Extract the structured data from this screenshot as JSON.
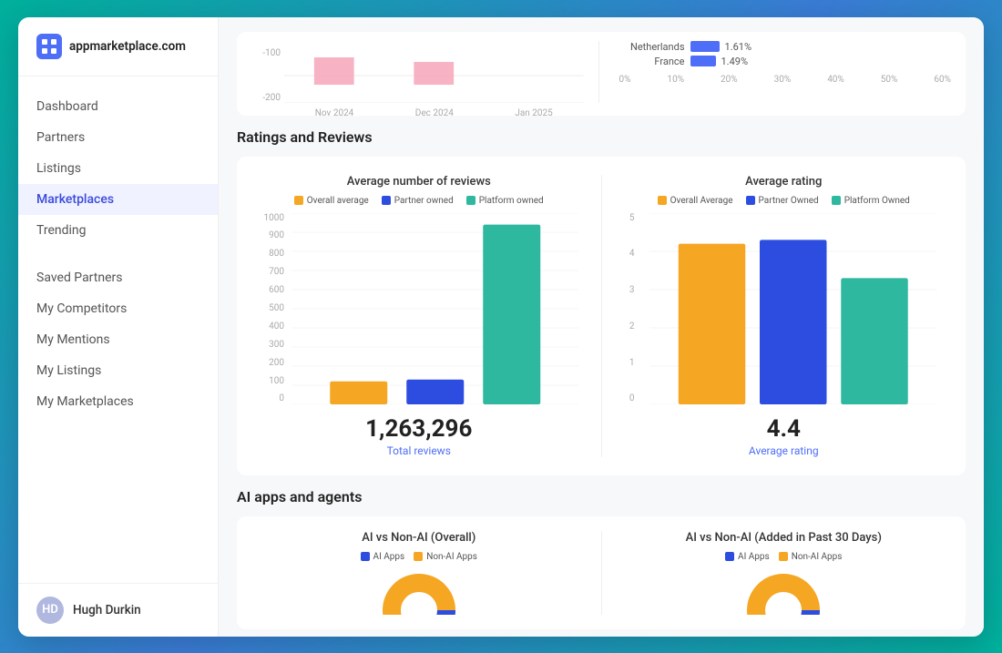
{
  "logo": {
    "domain": "appmarketplace.com"
  },
  "sidebar": {
    "nav_main": [
      {
        "label": "Dashboard",
        "active": false,
        "id": "dashboard"
      },
      {
        "label": "Partners",
        "active": false,
        "id": "partners"
      },
      {
        "label": "Listings",
        "active": false,
        "id": "listings"
      },
      {
        "label": "Marketplaces",
        "active": true,
        "id": "marketplaces"
      },
      {
        "label": "Trending",
        "active": false,
        "id": "trending"
      }
    ],
    "nav_secondary": [
      {
        "label": "Saved Partners",
        "active": false,
        "id": "saved-partners"
      },
      {
        "label": "My Competitors",
        "active": false,
        "id": "my-competitors"
      },
      {
        "label": "My Mentions",
        "active": false,
        "id": "my-mentions"
      },
      {
        "label": "My Listings",
        "active": false,
        "id": "my-listings"
      },
      {
        "label": "My Marketplaces",
        "active": false,
        "id": "my-marketplaces"
      }
    ],
    "user": {
      "name": "Hugh Durkin",
      "initials": "HD"
    }
  },
  "top_chart": {
    "left": {
      "y_labels": [
        "-100",
        "-200"
      ],
      "x_labels": [
        "Nov 2024",
        "Dec 2024",
        "Jan 2025"
      ]
    },
    "right": {
      "bars": [
        {
          "label": "Netherlands",
          "pct": "1.61%",
          "value": 1.61,
          "color": "#4f6ef7"
        },
        {
          "label": "France",
          "pct": "1.49%",
          "value": 1.49,
          "color": "#4f6ef7"
        }
      ],
      "axis": [
        "0%",
        "10%",
        "20%",
        "30%",
        "40%",
        "50%",
        "60%"
      ]
    }
  },
  "ratings_section": {
    "title": "Ratings and Reviews",
    "avg_reviews": {
      "chart_title": "Average number of reviews",
      "legend": [
        {
          "label": "Overall average",
          "color": "#f5a623"
        },
        {
          "label": "Partner owned",
          "color": "#2d4de0"
        },
        {
          "label": "Platform owned",
          "color": "#2eb8a0"
        }
      ],
      "bars": [
        {
          "label": "Overall average",
          "value": 120,
          "max": 1000,
          "color": "#f5a623"
        },
        {
          "label": "Partner owned",
          "value": 130,
          "max": 1000,
          "color": "#2d4de0"
        },
        {
          "label": "Platform owned",
          "value": 940,
          "max": 1000,
          "color": "#2eb8a0"
        }
      ],
      "y_labels": [
        "1000",
        "900",
        "800",
        "700",
        "600",
        "500",
        "400",
        "300",
        "200",
        "100",
        "0"
      ],
      "stat_number": "1,263,296",
      "stat_label": "Total reviews"
    },
    "avg_rating": {
      "chart_title": "Average rating",
      "legend": [
        {
          "label": "Overall Average",
          "color": "#f5a623"
        },
        {
          "label": "Partner Owned",
          "color": "#2d4de0"
        },
        {
          "label": "Platform Owned",
          "color": "#2eb8a0"
        }
      ],
      "bars": [
        {
          "label": "Overall Average",
          "value": 4.2,
          "max": 5,
          "color": "#f5a623"
        },
        {
          "label": "Partner Owned",
          "value": 4.3,
          "max": 5,
          "color": "#2d4de0"
        },
        {
          "label": "Platform Owned",
          "value": 3.3,
          "max": 5,
          "color": "#2eb8a0"
        }
      ],
      "y_labels": [
        "5",
        "4",
        "3",
        "2",
        "1",
        "0"
      ],
      "stat_number": "4.4",
      "stat_label": "Average rating"
    }
  },
  "ai_section": {
    "title": "AI apps and agents",
    "overall": {
      "chart_title": "AI vs Non-AI (Overall)",
      "legend": [
        {
          "label": "AI Apps",
          "color": "#2d4de0"
        },
        {
          "label": "Non-AI Apps",
          "color": "#f5a623"
        }
      ]
    },
    "past30": {
      "chart_title": "AI vs Non-AI (Added in Past 30 Days)",
      "legend": [
        {
          "label": "AI Apps",
          "color": "#2d4de0"
        },
        {
          "label": "Non-AI Apps",
          "color": "#f5a623"
        }
      ]
    }
  }
}
